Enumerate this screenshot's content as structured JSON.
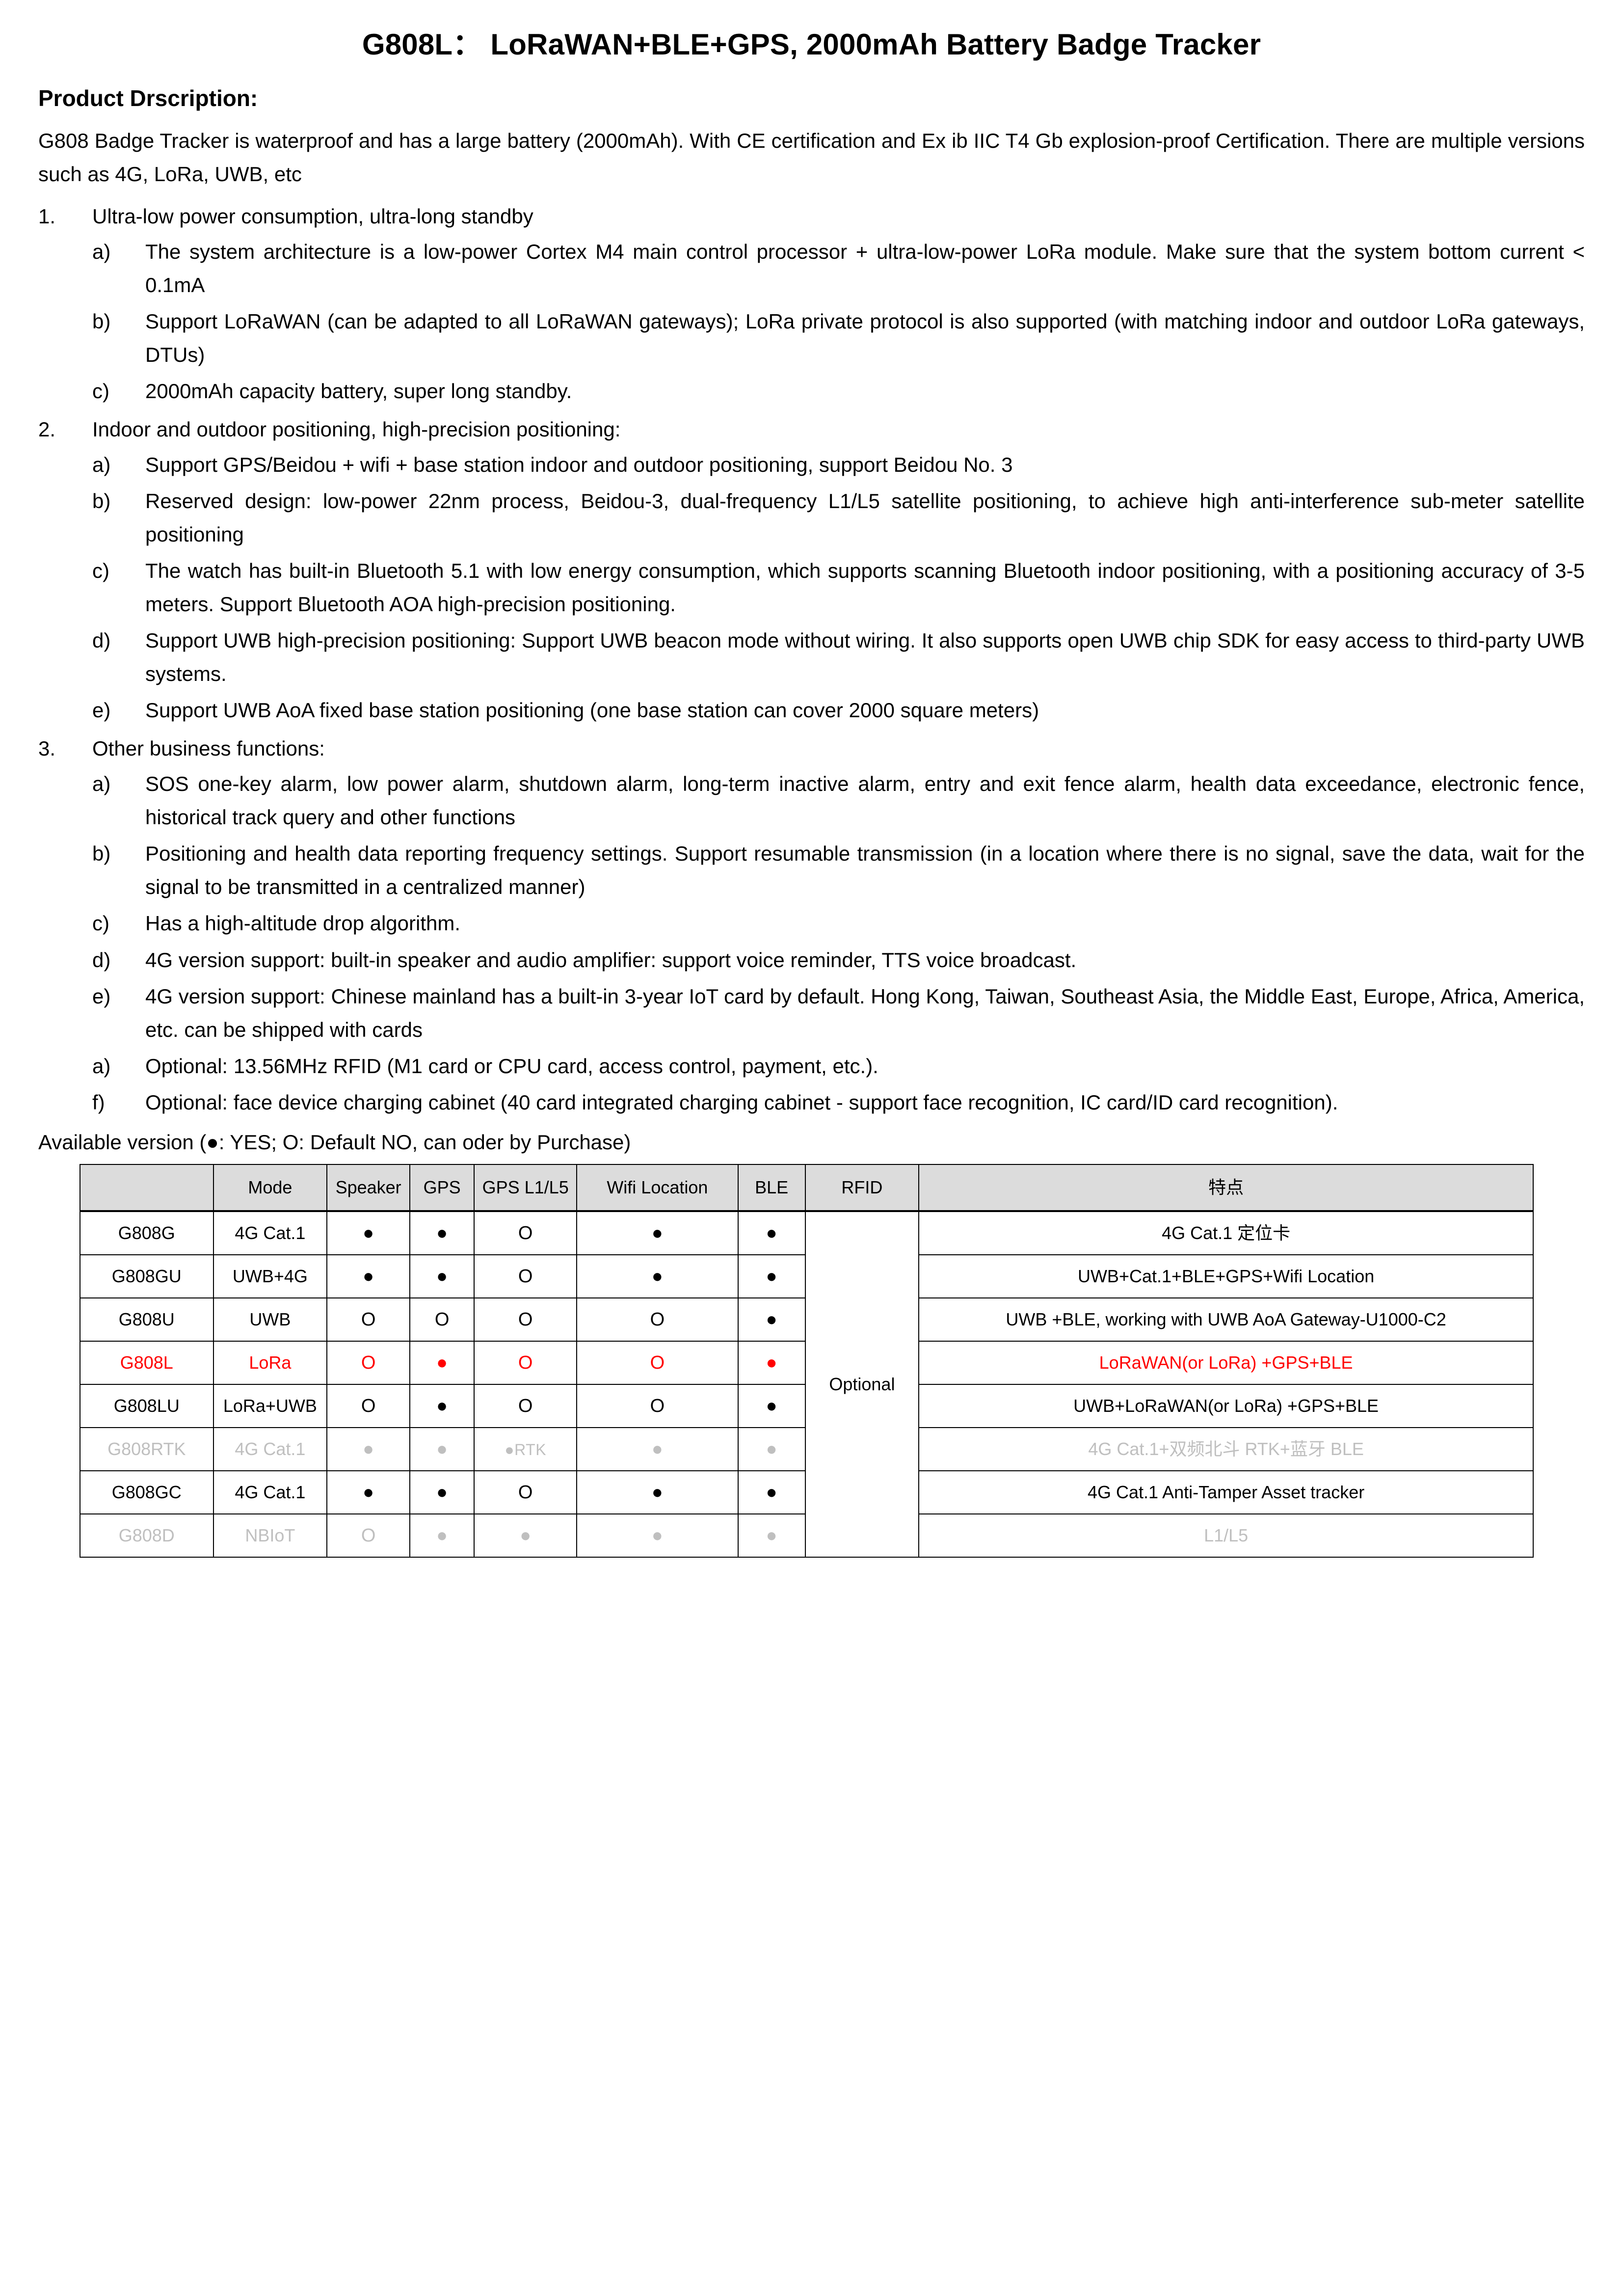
{
  "document": {
    "title": "G808L： LoRaWAN+BLE+GPS, 2000mAh Battery Badge Tracker",
    "section_heading": "Product Drscription:",
    "intro": "G808 Badge Tracker is waterproof and has a large battery (2000mAh). With CE certification and Ex ib IIC T4 Gb explosion-proof Certification. There are multiple versions such as 4G, LoRa, UWB, etc",
    "available_version_note": "Available version (●: YES; O: Default NO, can oder by Purchase)"
  },
  "sections": [
    {
      "marker": "1.",
      "text": "Ultra-low power consumption, ultra-long standby",
      "items": [
        {
          "marker": "a)",
          "text": "The system architecture is a low-power Cortex M4 main control processor + ultra-low-power LoRa module. Make sure that the system bottom current < 0.1mA"
        },
        {
          "marker": "b)",
          "text": "Support LoRaWAN (can be adapted to all LoRaWAN gateways); LoRa private protocol is also supported (with matching indoor and outdoor LoRa gateways, DTUs)"
        },
        {
          "marker": "c)",
          "text": "2000mAh capacity battery, super long standby."
        }
      ]
    },
    {
      "marker": "2.",
      "text": "Indoor and outdoor positioning, high-precision positioning:",
      "items": [
        {
          "marker": "a)",
          "text": "Support GPS/Beidou + wifi + base station indoor and outdoor positioning, support Beidou No. 3"
        },
        {
          "marker": "b)",
          "text": "Reserved design: low-power 22nm process, Beidou-3, dual-frequency L1/L5 satellite positioning, to achieve high anti-interference sub-meter satellite positioning"
        },
        {
          "marker": "c)",
          "text": "The watch has built-in Bluetooth 5.1 with low energy consumption, which supports scanning Bluetooth indoor positioning, with a positioning accuracy of 3-5 meters. Support Bluetooth AOA high-precision positioning."
        },
        {
          "marker": "d)",
          "text": "Support UWB high-precision positioning: Support UWB beacon mode without wiring. It also supports open UWB chip SDK for easy access to third-party UWB systems."
        },
        {
          "marker": "e)",
          "text": "Support UWB AoA fixed base station positioning (one base station can cover 2000 square meters)"
        }
      ]
    },
    {
      "marker": "3.",
      "text": "Other business functions:",
      "items": [
        {
          "marker": "a)",
          "text": "SOS one-key alarm, low power alarm, shutdown alarm, long-term inactive alarm, entry and exit fence alarm, health data exceedance, electronic fence, historical track query and other functions"
        },
        {
          "marker": "b)",
          "text": "Positioning and health data reporting frequency settings. Support resumable transmission (in a location where there is no signal, save the data, wait for the signal to be transmitted in a centralized manner)"
        },
        {
          "marker": "c)",
          "text": "Has a high-altitude drop algorithm."
        },
        {
          "marker": "d)",
          "text": "4G version support: built-in speaker and audio amplifier: support voice reminder, TTS voice broadcast."
        },
        {
          "marker": "e)",
          "text": "4G version support: Chinese mainland has a built-in 3-year IoT card by default. Hong Kong, Taiwan, Southeast Asia, the Middle East, Europe, Africa, America, etc. can be shipped with cards"
        },
        {
          "marker": "a)",
          "text": "Optional: 13.56MHz RFID (M1 card or CPU card, access control, payment, etc.)."
        },
        {
          "marker": "f)",
          "text": "Optional: face device charging cabinet (40 card integrated charging cabinet - support face recognition, IC card/ID card recognition)."
        }
      ]
    }
  ],
  "spec_table": {
    "headers": [
      "",
      "Mode",
      "Speaker",
      "GPS",
      "GPS L1/L5",
      "Wifi Location",
      "BLE",
      "RFID",
      "特点"
    ],
    "rfid_merged_value": "Optional",
    "rows": [
      {
        "model": "G808G",
        "mode": "4G Cat.1",
        "speaker": "●",
        "gps": "●",
        "gps_l1l5": "O",
        "wifi": "●",
        "ble": "●",
        "feature": "4G Cat.1 定位卡",
        "style": "normal"
      },
      {
        "model": "G808GU",
        "mode": "UWB+4G",
        "speaker": "●",
        "gps": "●",
        "gps_l1l5": "O",
        "wifi": "●",
        "ble": "●",
        "feature": "UWB+Cat.1+BLE+GPS+Wifi Location",
        "style": "normal"
      },
      {
        "model": "G808U",
        "mode": "UWB",
        "speaker": "O",
        "gps": "O",
        "gps_l1l5": "O",
        "wifi": "O",
        "ble": "●",
        "feature": "UWB +BLE, working with UWB AoA Gateway-U1000-C2",
        "style": "normal"
      },
      {
        "model": "G808L",
        "mode": "LoRa",
        "speaker": "O",
        "gps": "●",
        "gps_l1l5": "O",
        "wifi": "O",
        "ble": "●",
        "feature": "LoRaWAN(or LoRa) +GPS+BLE",
        "style": "red"
      },
      {
        "model": "G808LU",
        "mode": "LoRa+UWB",
        "speaker": "O",
        "gps": "●",
        "gps_l1l5": "O",
        "wifi": "O",
        "ble": "●",
        "feature": "UWB+LoRaWAN(or LoRa) +GPS+BLE",
        "style": "normal"
      },
      {
        "model": "G808RTK",
        "mode": "4G Cat.1",
        "speaker": "●",
        "gps": "●",
        "gps_l1l5": "●RTK",
        "wifi": "●",
        "ble": "●",
        "feature": "4G Cat.1+双频北斗 RTK+蓝牙 BLE",
        "style": "dim"
      },
      {
        "model": "G808GC",
        "mode": "4G Cat.1",
        "speaker": "●",
        "gps": "●",
        "gps_l1l5": "O",
        "wifi": "●",
        "ble": "●",
        "feature": "4G Cat.1 Anti-Tamper Asset tracker",
        "style": "normal"
      },
      {
        "model": "G808D",
        "mode": "NBIoT",
        "speaker": "O",
        "gps": "●",
        "gps_l1l5": "●",
        "wifi": "●",
        "ble": "●",
        "feature": "L1/L5",
        "style": "dim"
      }
    ]
  },
  "colors": {
    "highlight_red": "#ff0000",
    "dimmed_gray": "#bfbfbf",
    "header_fill": "#dcdcdc",
    "text": "#000000"
  }
}
